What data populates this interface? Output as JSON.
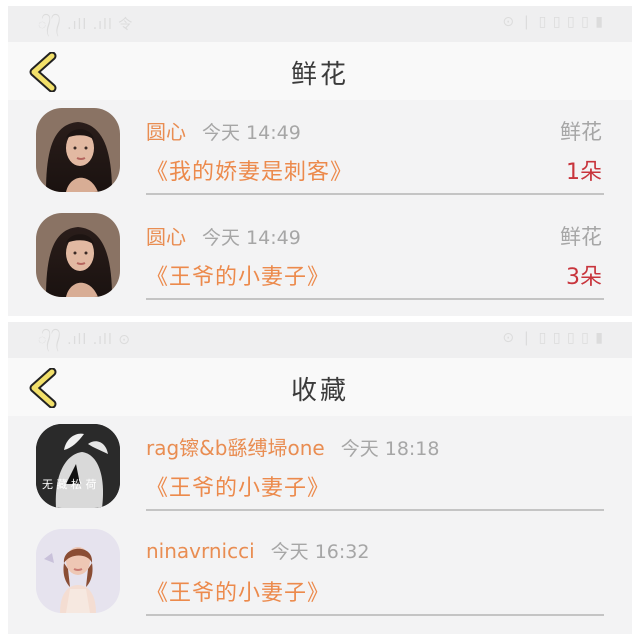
{
  "top": {
    "status_left": "᭄ ᭄ .ıll .ıll 令",
    "status_right": "⊙ ❘ ▯ ▯ ▯ ▯ ▮",
    "title": "鲜花",
    "rows": [
      {
        "user": "圆心",
        "time": "今天 14:49",
        "book": "《我的娇妻是刺客》",
        "kind": "鲜花",
        "count": "1朵"
      },
      {
        "user": "圆心",
        "time": "今天 14:49",
        "book": "《王爷的小妻子》",
        "kind": "鲜花",
        "count": "3朵"
      }
    ]
  },
  "bottom": {
    "status_left": "᭄ ᭄ .ıll .ıll ⊙",
    "status_right": "⊙ ❘ ▯ ▯ ▯ ▯ ▮",
    "title": "收藏",
    "rows": [
      {
        "user": "rag镲&b繇缚埽one",
        "time": "今天 18:18",
        "book": "《王爷的小妻子》",
        "avatar_text": "无 藏 松 荷"
      },
      {
        "user": "ninavrnicci",
        "time": "今天 16:32",
        "book": "《王爷的小妻子》"
      }
    ]
  },
  "colors": {
    "accent_orange": "#ec8a4c",
    "count_red": "#c8343c",
    "back_yellow": "#f2e06a"
  },
  "icons": {
    "back": "chevron-left-icon"
  }
}
